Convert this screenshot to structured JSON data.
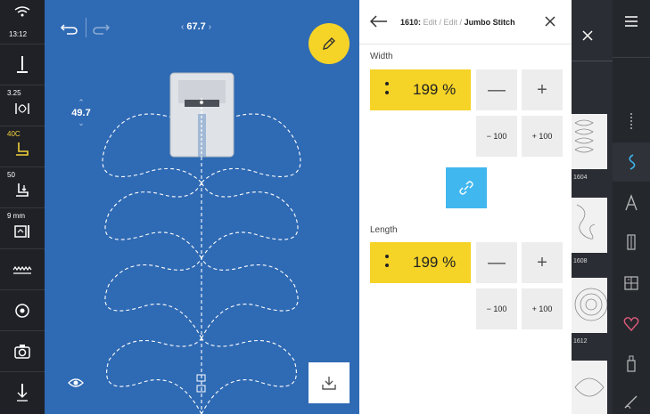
{
  "status": {
    "time": "13:12"
  },
  "left_toolbar": {
    "items": [
      {
        "name": "status",
        "top_label": "13:12",
        "icon": "wifi-icon"
      },
      {
        "name": "needle",
        "top_label": "",
        "icon": "needle-icon"
      },
      {
        "name": "stitch-width",
        "top_label": "3.25",
        "icon": "stitch-width-icon"
      },
      {
        "name": "foot",
        "top_label": "40C",
        "icon": "presser-foot-icon",
        "accent": "#f4d23a"
      },
      {
        "name": "stitch-plate",
        "top_label": "50",
        "icon": "stitch-plate-icon"
      },
      {
        "name": "bobbin",
        "top_label": "9 mm",
        "icon": "needle-plate-icon"
      },
      {
        "name": "feed-dog",
        "top_label": "",
        "icon": "feed-dog-icon"
      },
      {
        "name": "spool",
        "top_label": "",
        "icon": "spool-icon"
      },
      {
        "name": "camera",
        "top_label": "",
        "icon": "camera-icon"
      },
      {
        "name": "needle-down",
        "top_label": "",
        "icon": "needle-down-icon"
      }
    ]
  },
  "canvas": {
    "zoom_value": "67.7",
    "side_value": "49.7",
    "bg_color": "#2f6ab4"
  },
  "panel": {
    "breadcrumb": {
      "part1": "1610:",
      "part2": " Edit / Edit / ",
      "part3": "Jumbo Stitch"
    },
    "width": {
      "label": "Width",
      "value": "199 %",
      "minus": "—",
      "plus": "+",
      "minus100": "− 100",
      "plus100": "+ 100"
    },
    "length": {
      "label": "Length",
      "value": "199 %",
      "minus": "—",
      "plus": "+",
      "minus100": "− 100",
      "plus100": "+ 100"
    },
    "accent": "#f5d327",
    "link_color": "#41b7ef"
  },
  "stitch_list": {
    "tiles": [
      {
        "number": "1604"
      },
      {
        "number": "1608"
      },
      {
        "number": "1612"
      }
    ]
  },
  "right_menu": {
    "items": [
      "menu-icon",
      "straight-stitch-icon",
      "decorative-stitch-icon",
      "alphabet-icon",
      "buttonhole-icon",
      "quilt-icon",
      "heart-icon",
      "usb-icon",
      "needle-tip-icon"
    ]
  }
}
